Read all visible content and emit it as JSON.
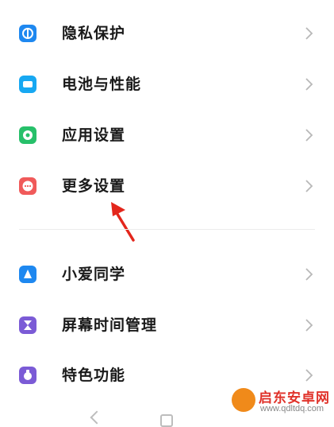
{
  "settings": {
    "items": [
      {
        "label": "隐私保护",
        "icon": "privacy-shield-icon",
        "color": "#1e88f0"
      },
      {
        "label": "电池与性能",
        "icon": "battery-icon",
        "color": "#17a8f2"
      },
      {
        "label": "应用设置",
        "icon": "app-settings-gear-icon",
        "color": "#27c06a"
      },
      {
        "label": "更多设置",
        "icon": "more-dots-icon",
        "color": "#f05a5a"
      },
      {
        "label": "小爱同学",
        "icon": "xiaoai-icon",
        "color": "#1e88f0"
      },
      {
        "label": "屏幕时间管理",
        "icon": "hourglass-icon",
        "color": "#7b5bd6"
      },
      {
        "label": "特色功能",
        "icon": "feature-icon",
        "color": "#7b5bd6"
      }
    ]
  },
  "annotation": {
    "color": "#e3261c"
  },
  "watermark": {
    "title": "启东安卓网",
    "url": "www.qdltdq.com"
  }
}
